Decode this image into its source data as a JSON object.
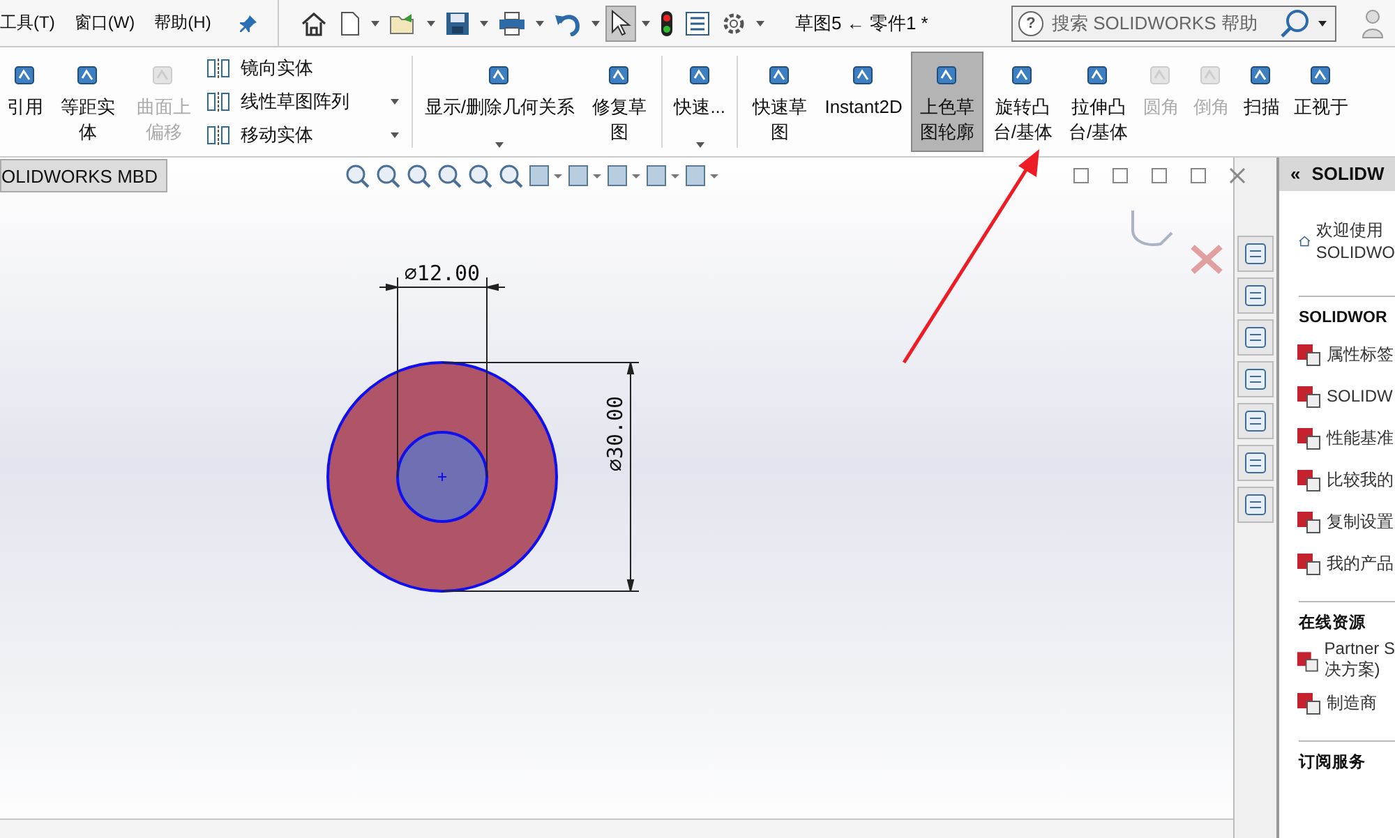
{
  "menu": [
    "工具(T)",
    "窗口(W)",
    "帮助(H)"
  ],
  "quick_access": [
    {
      "kind": "home",
      "dropdown": false,
      "selected": false
    },
    {
      "kind": "new",
      "dropdown": true,
      "selected": false
    },
    {
      "kind": "open",
      "dropdown": true,
      "selected": false
    },
    {
      "kind": "save",
      "dropdown": true,
      "selected": false
    },
    {
      "kind": "print",
      "dropdown": true,
      "selected": false
    },
    {
      "kind": "undo",
      "dropdown": true,
      "selected": false
    },
    {
      "kind": "select",
      "dropdown": true,
      "selected": true
    },
    {
      "kind": "rebuild",
      "dropdown": false,
      "selected": false
    },
    {
      "kind": "list",
      "dropdown": false,
      "selected": false
    },
    {
      "kind": "options",
      "dropdown": true,
      "selected": false
    }
  ],
  "title": "草图5 ← 零件1 *",
  "search": {
    "help_glyph": "?",
    "placeholder": "搜索 SOLIDWORKS 帮助"
  },
  "ribbon": [
    {
      "items": [
        {
          "kind": "large",
          "label": "引用",
          "disabled": false,
          "selected": false,
          "dropdown": false
        },
        {
          "kind": "large",
          "label": "等距实体",
          "disabled": false,
          "selected": false,
          "dropdown": false
        },
        {
          "kind": "large",
          "label": "曲面上偏移",
          "disabled": true,
          "selected": false,
          "dropdown": false
        },
        {
          "kind": "stack",
          "rows": [
            {
              "label": "镜向实体",
              "dropdown": false
            },
            {
              "label": "线性草图阵列",
              "dropdown": true
            },
            {
              "label": "移动实体",
              "dropdown": true
            }
          ]
        }
      ]
    },
    {
      "items": [
        {
          "kind": "wide",
          "label": "显示/删除几何关系",
          "disabled": false,
          "selected": false,
          "dropdown": true
        },
        {
          "kind": "large",
          "label": "修复草图",
          "disabled": false,
          "selected": false,
          "dropdown": false
        }
      ]
    },
    {
      "items": [
        {
          "kind": "large",
          "label": "快速...",
          "disabled": false,
          "selected": false,
          "dropdown": true
        }
      ]
    },
    {
      "items": [
        {
          "kind": "large",
          "label": "快速草图",
          "disabled": false,
          "selected": false,
          "dropdown": false
        },
        {
          "kind": "wide",
          "label": "Instant2D",
          "disabled": false,
          "selected": false,
          "dropdown": false
        },
        {
          "kind": "large",
          "label": "上色草图轮廓",
          "disabled": false,
          "selected": true,
          "dropdown": false
        },
        {
          "kind": "large",
          "label": "旋转凸台/基体",
          "disabled": false,
          "selected": false,
          "dropdown": false
        },
        {
          "kind": "large",
          "label": "拉伸凸台/基体",
          "disabled": false,
          "selected": false,
          "dropdown": false
        },
        {
          "kind": "large",
          "label": "圆角",
          "disabled": true,
          "selected": false,
          "dropdown": false
        },
        {
          "kind": "large",
          "label": "倒角",
          "disabled": true,
          "selected": false,
          "dropdown": false
        },
        {
          "kind": "large",
          "label": "扫描",
          "disabled": false,
          "selected": false,
          "dropdown": false
        },
        {
          "kind": "large",
          "label": "正视于",
          "disabled": false,
          "selected": false,
          "dropdown": false
        }
      ]
    }
  ],
  "tab": {
    "label": "OLIDWORKS MBD"
  },
  "sketch": {
    "small_dimension": "∅12.00",
    "large_dimension": "∅30.00"
  },
  "task_pane": {
    "collapse_glyph": "«",
    "title": "SOLIDW",
    "welcome": "欢迎使用\nSOLIDWO",
    "sections": [
      {
        "heading": "SOLIDWOR",
        "items": [
          "属性标签",
          "SOLIDW",
          "性能基准",
          "比较我的",
          "复制设置",
          "我的产品"
        ]
      },
      {
        "heading": "在线资源",
        "items": [
          "Partner S\n决方案)",
          "制造商"
        ]
      },
      {
        "heading": "订阅服务"
      }
    ]
  }
}
